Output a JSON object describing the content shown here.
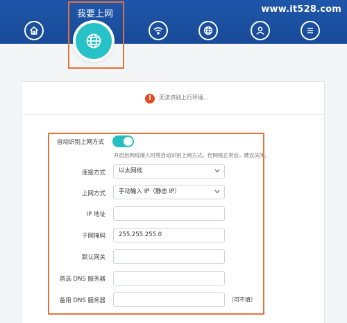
{
  "header": {
    "watermark": "www.it528.com",
    "active_tab_label": "我要上网",
    "accent": "#26c2c7",
    "tabs": [
      {
        "name": "home",
        "icon": "home-icon"
      },
      {
        "name": "internet",
        "icon": "globe-icon",
        "active": true
      },
      {
        "name": "wifi",
        "icon": "wifi-icon"
      },
      {
        "name": "network",
        "icon": "globe-grid-icon"
      },
      {
        "name": "user",
        "icon": "user-icon"
      },
      {
        "name": "menu",
        "icon": "menu-icon"
      }
    ]
  },
  "status": {
    "icon": "warning-icon",
    "text": "无法识别上行环境..."
  },
  "form": {
    "auto_detect_label": "自动识别上网方式",
    "auto_detect_on": true,
    "hint": "开启后网线接入时将自动识别上网方式，但网络正常后，建议关闭。",
    "connection_type": {
      "label": "连接方式",
      "value": "以太网线"
    },
    "wan_mode": {
      "label": "上网方式",
      "value": "手动输入 IP（静态 IP）"
    },
    "ip_address": {
      "label": "IP 地址",
      "value": ""
    },
    "subnet_mask": {
      "label": "子网掩码",
      "value": "255.255.255.0"
    },
    "gateway": {
      "label": "默认网关",
      "value": ""
    },
    "dns_primary": {
      "label": "首选 DNS 服务器",
      "value": ""
    },
    "dns_secondary": {
      "label": "备用 DNS 服务器",
      "value": "",
      "note": "（可不填）"
    }
  }
}
